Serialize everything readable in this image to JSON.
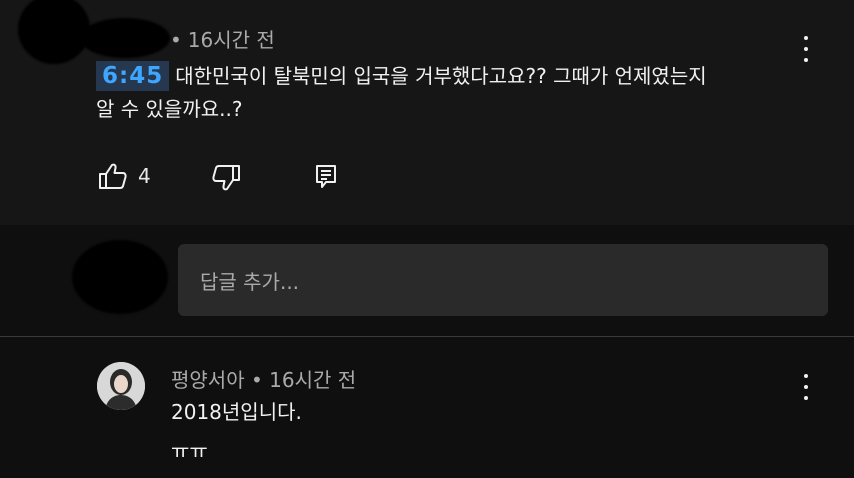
{
  "comment": {
    "author_redacted": true,
    "time": "16시간 전",
    "separator": "•",
    "timestamp_link": "6:45",
    "text_line1": "대한민국이 탈북민의 입국을 거부했다고요?? 그때가 언제였는지",
    "text_line2": "알 수 있을까요..?",
    "likes": "4",
    "icons": {
      "like": "thumbs-up-icon",
      "dislike": "thumbs-down-icon",
      "reply": "reply-icon",
      "menu": "more-vert-icon"
    }
  },
  "reply_box": {
    "placeholder": "답글 추가..."
  },
  "reply": {
    "author": "평양서아",
    "separator": "•",
    "time": "16시간 전",
    "text_line1": "2018년입니다.",
    "text_line2": "ㅠㅠ"
  }
}
